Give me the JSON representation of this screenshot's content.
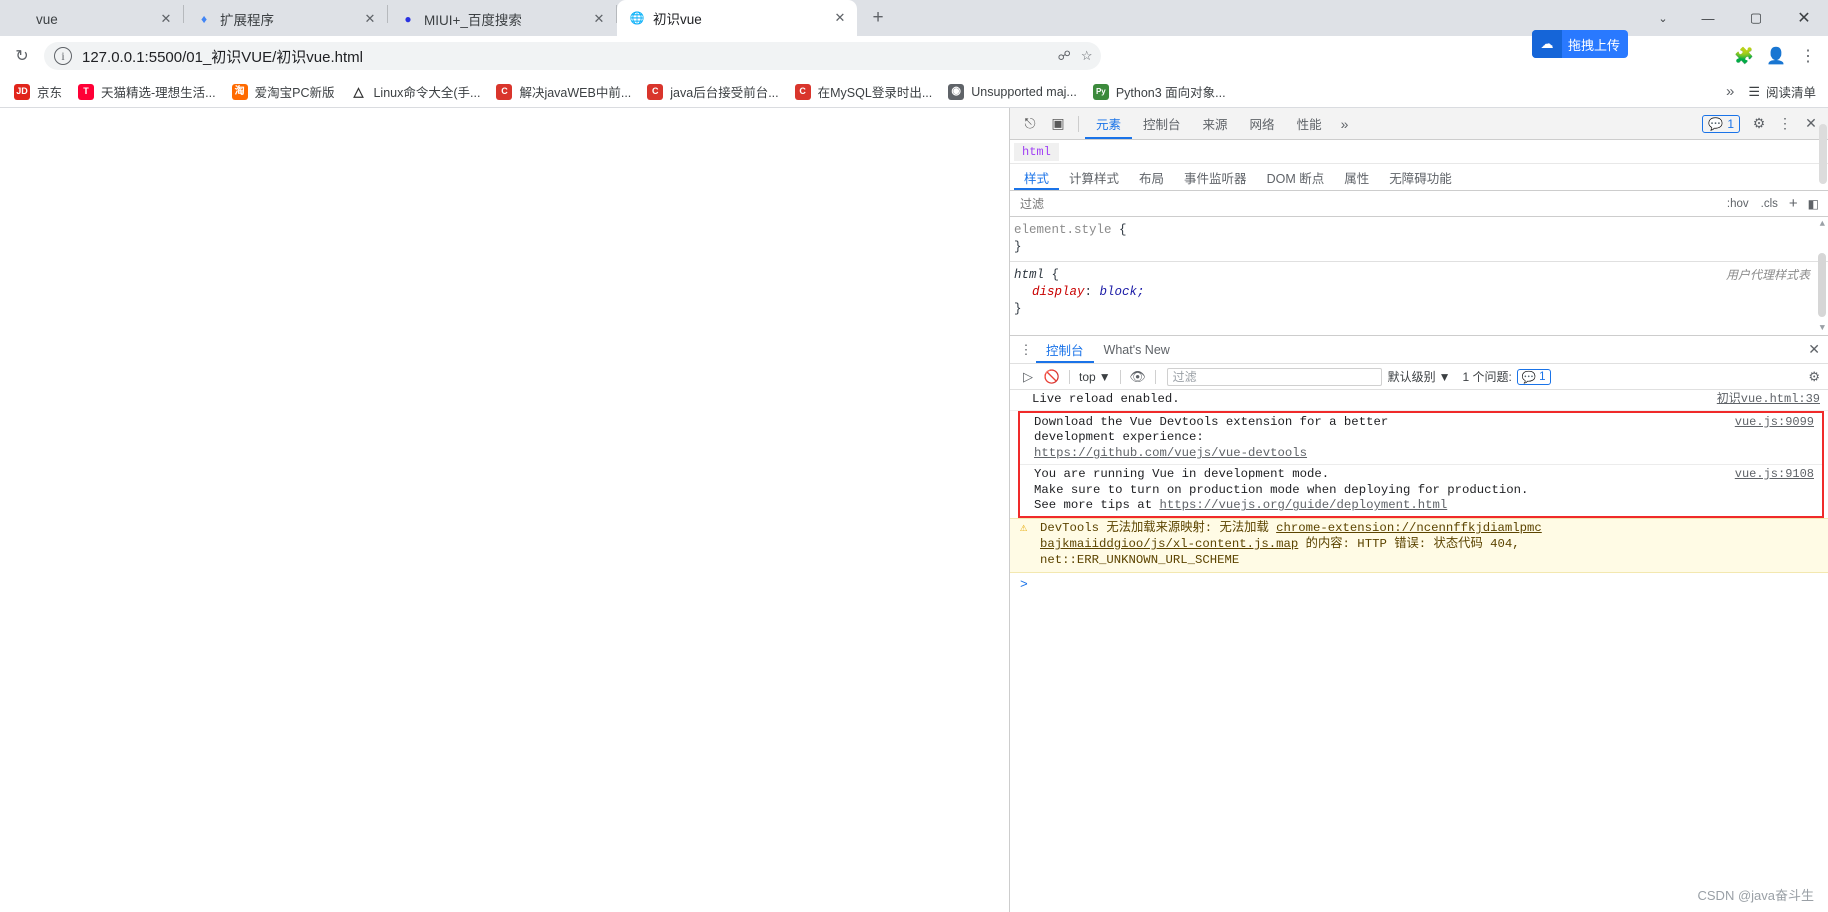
{
  "browser": {
    "tabs": [
      {
        "title": "vue",
        "favicon": "",
        "favicon_color": "#ffffff",
        "active": false,
        "closable": true
      },
      {
        "title": "扩展程序",
        "favicon": "puzzle-icon",
        "favicon_color": "#4285f4",
        "active": false,
        "closable": true
      },
      {
        "title": "MIUI+_百度搜索",
        "favicon": "baidu-icon",
        "favicon_color": "#2932e1",
        "active": false,
        "closable": true
      },
      {
        "title": "初识vue",
        "favicon": "globe-icon",
        "favicon_color": "#5f6368",
        "active": true,
        "closable": true
      }
    ],
    "new_tab_label": "+",
    "window_controls": {
      "chevron": "⌄",
      "minimize": "—",
      "maximize": "▢",
      "close": "✕"
    },
    "toolbar": {
      "reload_icon": "reload-icon",
      "info_icon": "ⓘ",
      "url": "127.0.0.1:5500/01_初识VUE/初识vue.html",
      "upload_pill": {
        "label": "拖拽上传",
        "icon": "upload-icon",
        "color": "#2979ff"
      },
      "share_icon": "share-icon",
      "bookmark_icon": "star-icon",
      "extensions_icon": "puzzle-icon",
      "profile_icon": "profile-icon",
      "menu_icon": "kebab-icon"
    },
    "bookmarks": [
      {
        "label": "京东",
        "icon_text": "JD",
        "icon_color": "#e1251b"
      },
      {
        "label": "天猫精选-理想生活...",
        "icon_text": "T",
        "icon_color": "#ff0036"
      },
      {
        "label": "爱淘宝PC新版",
        "icon_text": "淘",
        "icon_color": "#ff6a00"
      },
      {
        "label": "Linux命令大全(手...",
        "icon_text": "△",
        "icon_color": "#ffffff"
      },
      {
        "label": "解决javaWEB中前...",
        "icon_text": "C",
        "icon_color": "#d9352c"
      },
      {
        "label": "java后台接受前台...",
        "icon_text": "C",
        "icon_color": "#d9352c"
      },
      {
        "label": "在MySQL登录时出...",
        "icon_text": "C",
        "icon_color": "#d9352c"
      },
      {
        "label": "Unsupported maj...",
        "icon_text": "◍",
        "icon_color": "#5f6368"
      },
      {
        "label": "Python3 面向对象...",
        "icon_text": "Py",
        "icon_color": "#3c8a3c"
      }
    ],
    "bookmarks_overflow": "»",
    "reading_list": {
      "label": "阅读清单",
      "icon": "reading-list-icon"
    }
  },
  "devtools": {
    "toolbar_icons": {
      "inspect": "inspect-icon",
      "device": "device-toggle-icon"
    },
    "tabs": [
      {
        "label": "元素",
        "active": true
      },
      {
        "label": "控制台",
        "active": false
      },
      {
        "label": "来源",
        "active": false
      },
      {
        "label": "网络",
        "active": false
      },
      {
        "label": "性能",
        "active": false
      }
    ],
    "more_tabs": "»",
    "issues_badge": {
      "count": "1",
      "icon": "message-icon"
    },
    "settings_icon": "gear-icon",
    "menu_icon": "kebab-icon",
    "close_icon": "close-icon",
    "breadcrumb": [
      "html"
    ],
    "sub_tabs": [
      {
        "label": "样式",
        "active": true
      },
      {
        "label": "计算样式",
        "active": false
      },
      {
        "label": "布局",
        "active": false
      },
      {
        "label": "事件监听器",
        "active": false
      },
      {
        "label": "DOM 断点",
        "active": false
      },
      {
        "label": "属性",
        "active": false
      },
      {
        "label": "无障碍功能",
        "active": false
      }
    ],
    "filter_placeholder": "过滤",
    "filter_hov": ":hov",
    "filter_cls": ".cls",
    "filter_plus": "+",
    "filter_panel": "◧",
    "styles": {
      "ua_note": "用户代理样式表",
      "rules": [
        {
          "selector": "element.style",
          "selector_style": "gray",
          "open_brace": "{",
          "close_brace": "}",
          "declarations": []
        },
        {
          "selector": "html",
          "selector_style": "italic",
          "open_brace": "{",
          "close_brace": "}",
          "declarations": [
            {
              "property": "display",
              "value": "block;"
            }
          ]
        }
      ]
    },
    "drawer": {
      "tabs": [
        {
          "label": "控制台",
          "active": true
        },
        {
          "label": "What's New",
          "active": false
        }
      ],
      "close_icon": "close-icon",
      "console_toolbar": {
        "sidebar_icon": "console-sidebar-icon",
        "clear_icon": "clear-console-icon",
        "context_label": "top",
        "context_caret": "▼",
        "eye_icon": "live-expression-icon",
        "filter_placeholder": "过滤",
        "level_label": "默认级别",
        "level_caret": "▼",
        "issues_label": "1 个问题:",
        "issues_count": "1",
        "issues_icon": "message-icon",
        "gear_icon": "gear-icon"
      },
      "messages": [
        {
          "type": "log",
          "lines": [
            "Live reload enabled."
          ],
          "anchor": "初识vue.html:39",
          "highlighted": false
        },
        {
          "type": "log",
          "lines": [
            "Download the Vue Devtools extension for a better",
            "development experience:",
            "https://github.com/vuejs/vue-devtools"
          ],
          "link_line_index": 2,
          "anchor": "vue.js:9099",
          "highlighted": true
        },
        {
          "type": "log",
          "lines": [
            "You are running Vue in development mode.",
            "Make sure to turn on production mode when deploying for production.",
            "See more tips at https://vuejs.org/guide/deployment.html"
          ],
          "anchor": "vue.js:9108",
          "highlighted": true
        },
        {
          "type": "warning",
          "icon": "warning-icon",
          "lines": [
            "DevTools 无法加载来源映射: 无法加载 chrome-extension://ncennffkjdiamlpmc",
            "bajkmaiiddgioo/js/xl-content.js.map 的内容: HTTP 错误: 状态代码 404,",
            "net::ERR_UNKNOWN_URL_SCHEME"
          ],
          "highlighted": false
        }
      ],
      "prompt_caret": ">"
    }
  },
  "watermark": "CSDN @java奋斗生",
  "colors": {
    "accent_blue": "#1a73e8",
    "error_red": "#f02a2a",
    "warn_bg": "#fffbe5",
    "tabstrip_bg": "#dee1e6",
    "upload_blue": "#2979ff"
  }
}
